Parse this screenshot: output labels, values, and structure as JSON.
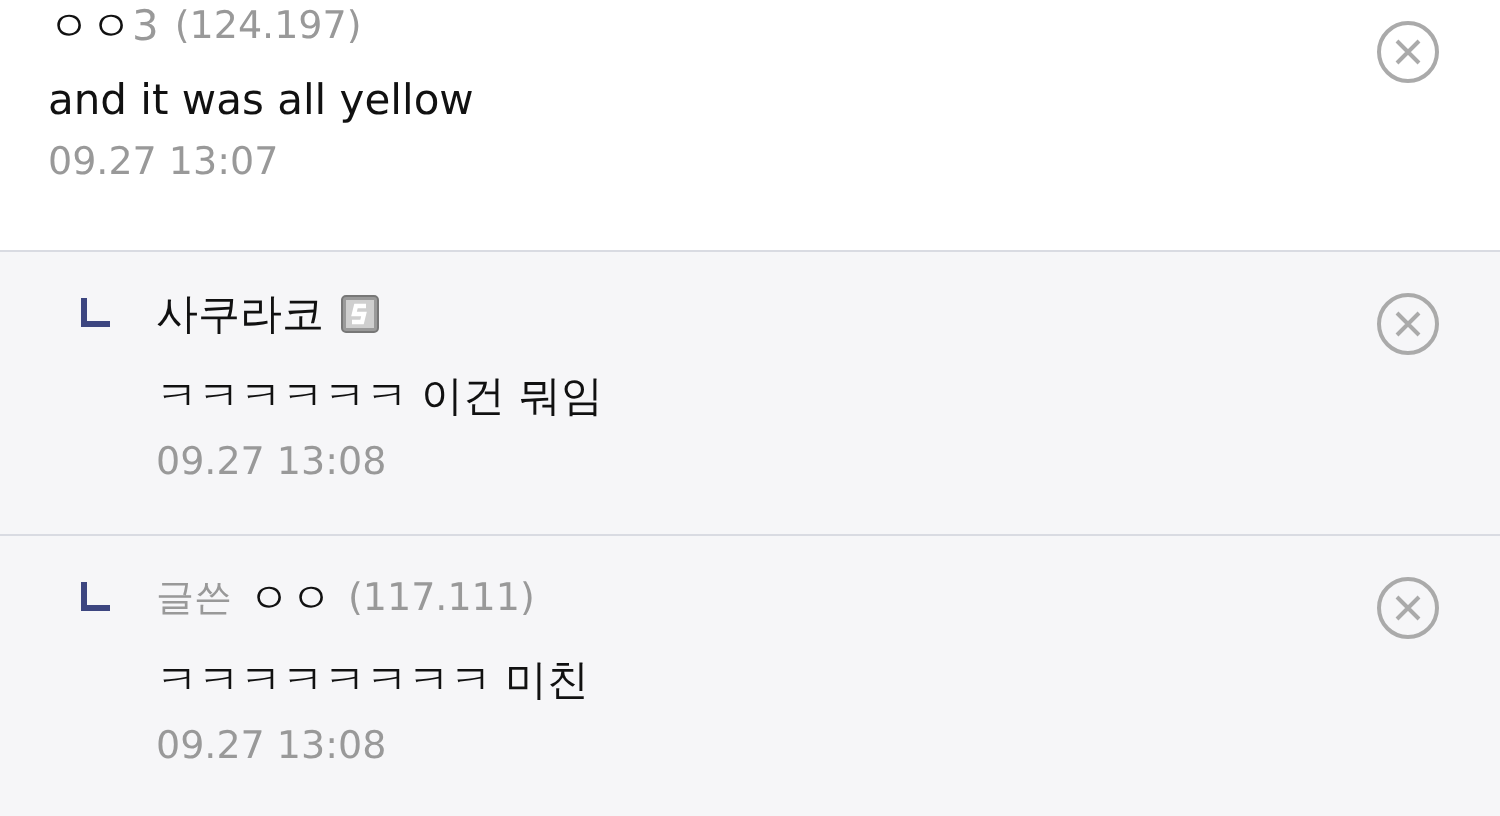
{
  "comments": [
    {
      "kind": "comment",
      "name": "ㅇㅇ",
      "name_suffix": "3",
      "ip": "(124.197)",
      "text": "and it was all yellow",
      "time": "09.27 13:07"
    },
    {
      "kind": "reply",
      "name": "사쿠라코",
      "member_badge": true,
      "text": "ㅋㅋㅋㅋㅋㅋ 이건 뭐임",
      "time": "09.27 13:08"
    },
    {
      "kind": "reply",
      "author_label": "글쓴",
      "name": "ㅇㅇ",
      "ip": "(117.111)",
      "text": "ㅋㅋㅋㅋㅋㅋㅋㅋ 미친",
      "time": "09.27 13:08"
    }
  ]
}
